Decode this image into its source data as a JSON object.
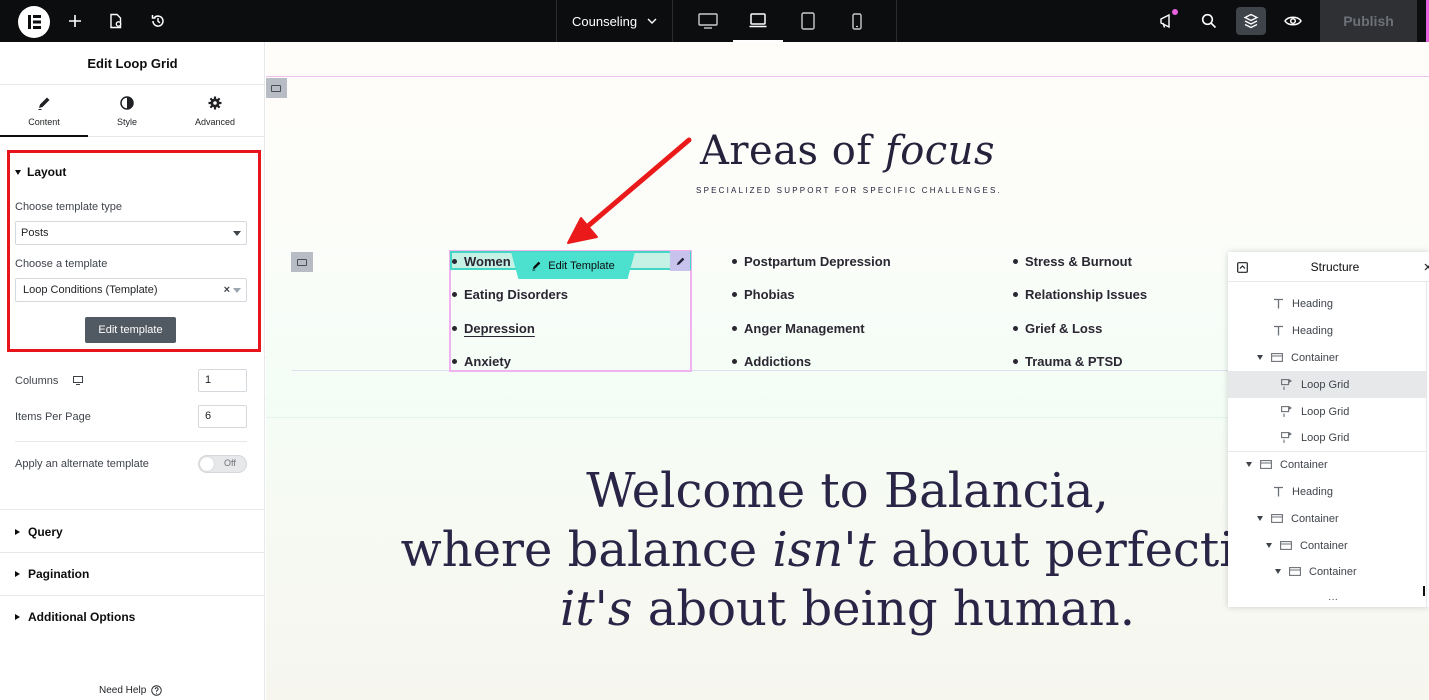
{
  "topbar": {
    "page_name": "Counseling",
    "publish_label": "Publish",
    "accent_color": "#e862e0"
  },
  "panel": {
    "title": "Edit Loop Grid",
    "tabs": [
      {
        "label": "Content",
        "icon": "pencil-icon"
      },
      {
        "label": "Style",
        "icon": "half-circle-icon"
      },
      {
        "label": "Advanced",
        "icon": "gear-icon"
      }
    ],
    "layout": {
      "heading": "Layout",
      "template_type_label": "Choose template type",
      "template_type_value": "Posts",
      "template_label": "Choose a template",
      "template_value": "Loop Conditions (Template)",
      "edit_button": "Edit template",
      "columns_label": "Columns",
      "columns_value": "1",
      "items_label": "Items Per Page",
      "items_value": "6",
      "alternate_label": "Apply an alternate template",
      "toggle_text": "Off"
    },
    "sections": [
      "Query",
      "Pagination",
      "Additional Options"
    ],
    "help": "Need Help"
  },
  "canvas": {
    "heading_plain": "Areas of",
    "heading_italic": "focus",
    "subtitle": "SPECIALIZED SUPPORT FOR SPECIFIC CHALLENGES.",
    "columns": [
      [
        "Women",
        "Eating Disorders",
        "Depression",
        "Anxiety"
      ],
      [
        "Postpartum Depression",
        "Phobias",
        "Anger Management",
        "Addictions"
      ],
      [
        "Stress & Burnout",
        "Relationship Issues",
        "Grief & Loss",
        "Trauma & PTSD"
      ]
    ],
    "edit_template_label": "Edit Template",
    "welcome": {
      "line1": "Welcome to Balancia,",
      "line2_a": "where balance ",
      "line2_b": "isn't",
      "line2_c": " about perfection",
      "line3_a": "it's",
      "line3_b": " about being human."
    }
  },
  "structure": {
    "title": "Structure",
    "rows": [
      {
        "label": "Heading",
        "type": "heading"
      },
      {
        "label": "Heading",
        "type": "heading"
      },
      {
        "label": "Container",
        "type": "container"
      },
      {
        "label": "Loop Grid",
        "type": "loop-grid"
      },
      {
        "label": "Loop Grid",
        "type": "loop-grid"
      },
      {
        "label": "Loop Grid",
        "type": "loop-grid"
      },
      {
        "label": "Container",
        "type": "container"
      },
      {
        "label": "Heading",
        "type": "heading"
      },
      {
        "label": "Container",
        "type": "container"
      },
      {
        "label": "Container",
        "type": "container"
      },
      {
        "label": "Container",
        "type": "container"
      }
    ]
  }
}
